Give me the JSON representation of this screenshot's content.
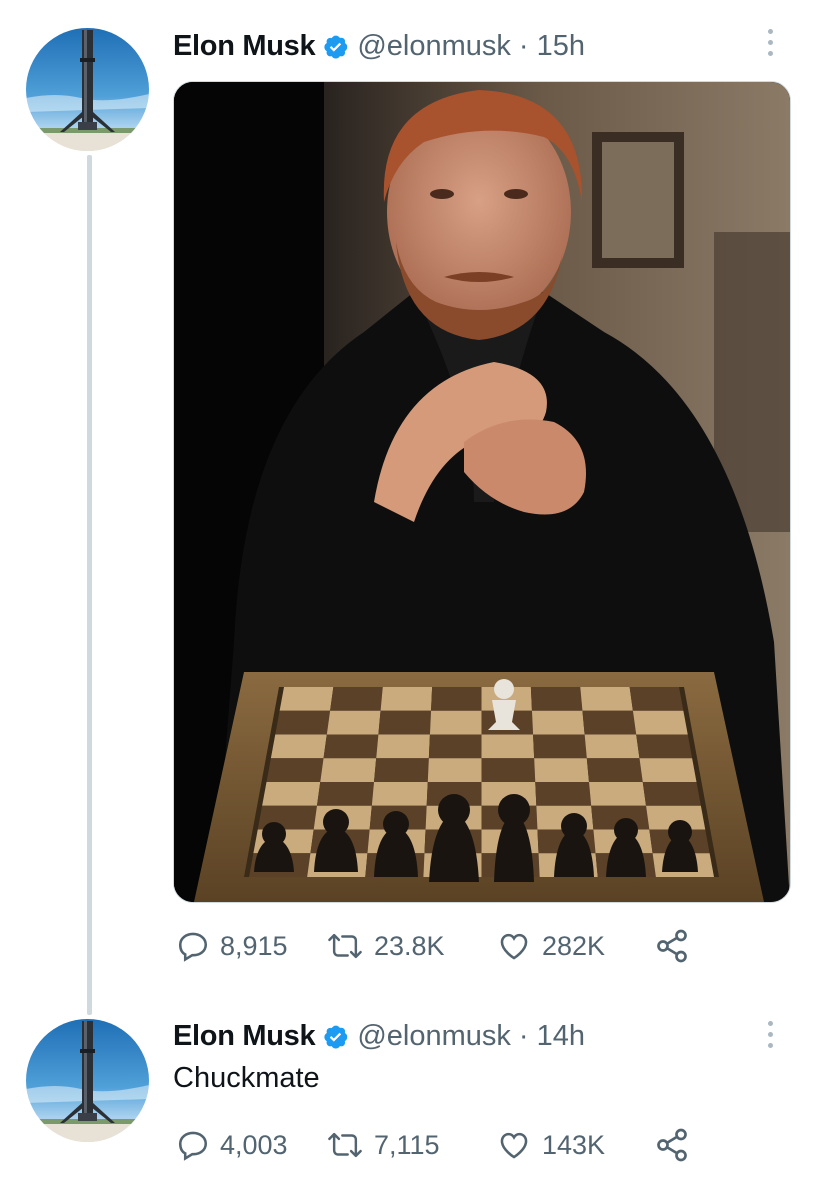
{
  "tweets": [
    {
      "author": "Elon Musk",
      "handle": "@elonmusk",
      "separator": "·",
      "time": "15h",
      "text": "",
      "has_media": true,
      "stats": {
        "replies": "8,915",
        "retweets": "23.8K",
        "likes": "282K"
      }
    },
    {
      "author": "Elon Musk",
      "handle": "@elonmusk",
      "separator": "·",
      "time": "14h",
      "text": "Chuckmate",
      "has_media": false,
      "stats": {
        "replies": "4,003",
        "retweets": "7,115",
        "likes": "143K"
      }
    }
  ],
  "colors": {
    "verified_badge": "#1d9bf0",
    "secondary_text": "#536471",
    "thread_line": "#cfd9de"
  },
  "icons": [
    "more-options-icon",
    "verified-badge-icon",
    "reply-icon",
    "retweet-icon",
    "like-icon",
    "share-icon"
  ]
}
